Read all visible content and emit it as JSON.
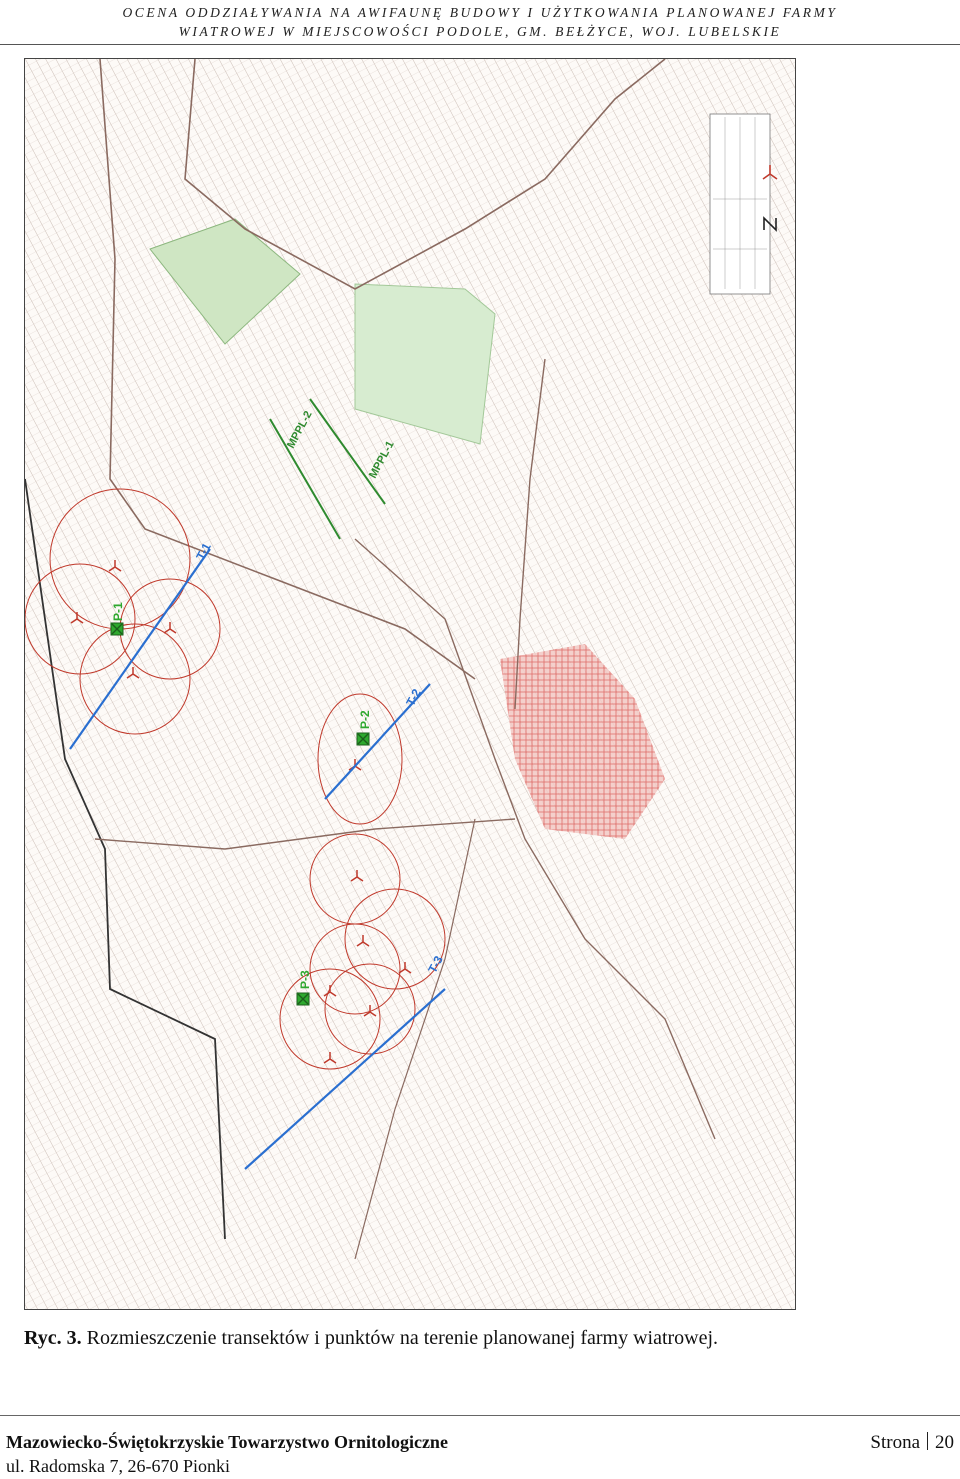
{
  "header": {
    "line1": "OCENA ODDZIAŁYWANIA NA AWIFAUNĘ BUDOWY I UŻYTKOWANIA PLANOWANEJ FARMY",
    "line2": "WIATROWEJ W MIEJSCOWOŚCI PODOLE, GM. BEŁŻYCE, WOJ. LUBELSKIE"
  },
  "map": {
    "labels": {
      "mppl2": "MPPL-2",
      "mppl1": "MPPL-1",
      "t1": "T-1",
      "t2": "T-2",
      "t3": "T-3",
      "p1": "P-1",
      "p2": "P-2",
      "p3": "P-3"
    },
    "colors": {
      "transect": "#2a6fd0",
      "mppl": "#2f8a2f",
      "point": "#2ea82e",
      "buffer": "#c0392b",
      "parcel": "#c9b9b0",
      "field_green": "#cfe6c3",
      "town": "#d9534f"
    },
    "icons": [
      "north-arrow-icon",
      "turbine-icon",
      "point-marker-icon"
    ]
  },
  "caption": {
    "number": "Ryc. 3.",
    "text": "Rozmieszczenie transektów i punktów na terenie planowanej farmy wiatrowej."
  },
  "footer": {
    "organization": "Mazowiecko-Świętokrzyskie Towarzystwo Ornitologiczne",
    "address": "ul. Radomska 7, 26-670 Pionki",
    "page_label": "Strona",
    "page_number": "20"
  }
}
